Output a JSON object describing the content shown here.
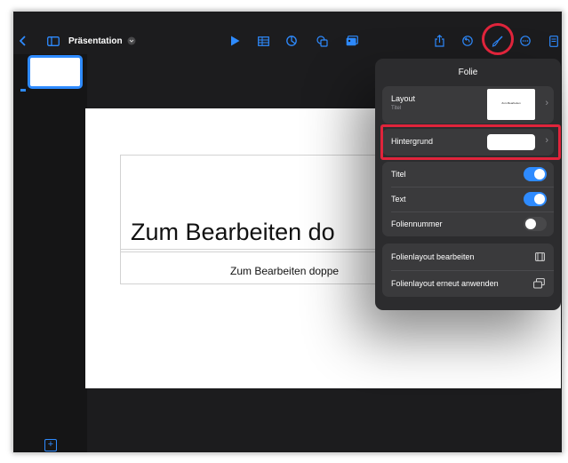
{
  "toolbar": {
    "back_icon": "chevron-left-icon",
    "sidebar_icon": "sidebar-icon",
    "doc_title": "Präsentation",
    "title_menu_icon": "chevron-down-circle-icon",
    "play_icon": "play-icon",
    "table_icon": "table-icon",
    "chart_icon": "chart-icon",
    "shape_icon": "shape-icon",
    "media_icon": "media-icon",
    "share_icon": "share-icon",
    "undo_icon": "undo-icon",
    "format_icon": "paintbrush-icon",
    "more_icon": "more-icon",
    "document_icon": "document-icon",
    "accent": "#2e8bff"
  },
  "slide": {
    "title": "Zum Bearbeiten do",
    "subtitle": "Zum Bearbeiten doppe"
  },
  "popover": {
    "title": "Folie",
    "layout": {
      "label": "Layout",
      "sublabel": "Titel",
      "thumb_text": "Zum Bearbeiten"
    },
    "background": {
      "label": "Hintergrund"
    },
    "toggles": [
      {
        "label": "Titel",
        "on": true
      },
      {
        "label": "Text",
        "on": true
      },
      {
        "label": "Foliennummer",
        "on": false
      }
    ],
    "actions": [
      {
        "label": "Folienlayout bearbeiten",
        "icon": "layout-edit-icon"
      },
      {
        "label": "Folienlayout erneut anwenden",
        "icon": "reapply-layout-icon"
      }
    ]
  },
  "highlight_color": "#e0243b",
  "toggle_on_color": "#2e8bff"
}
